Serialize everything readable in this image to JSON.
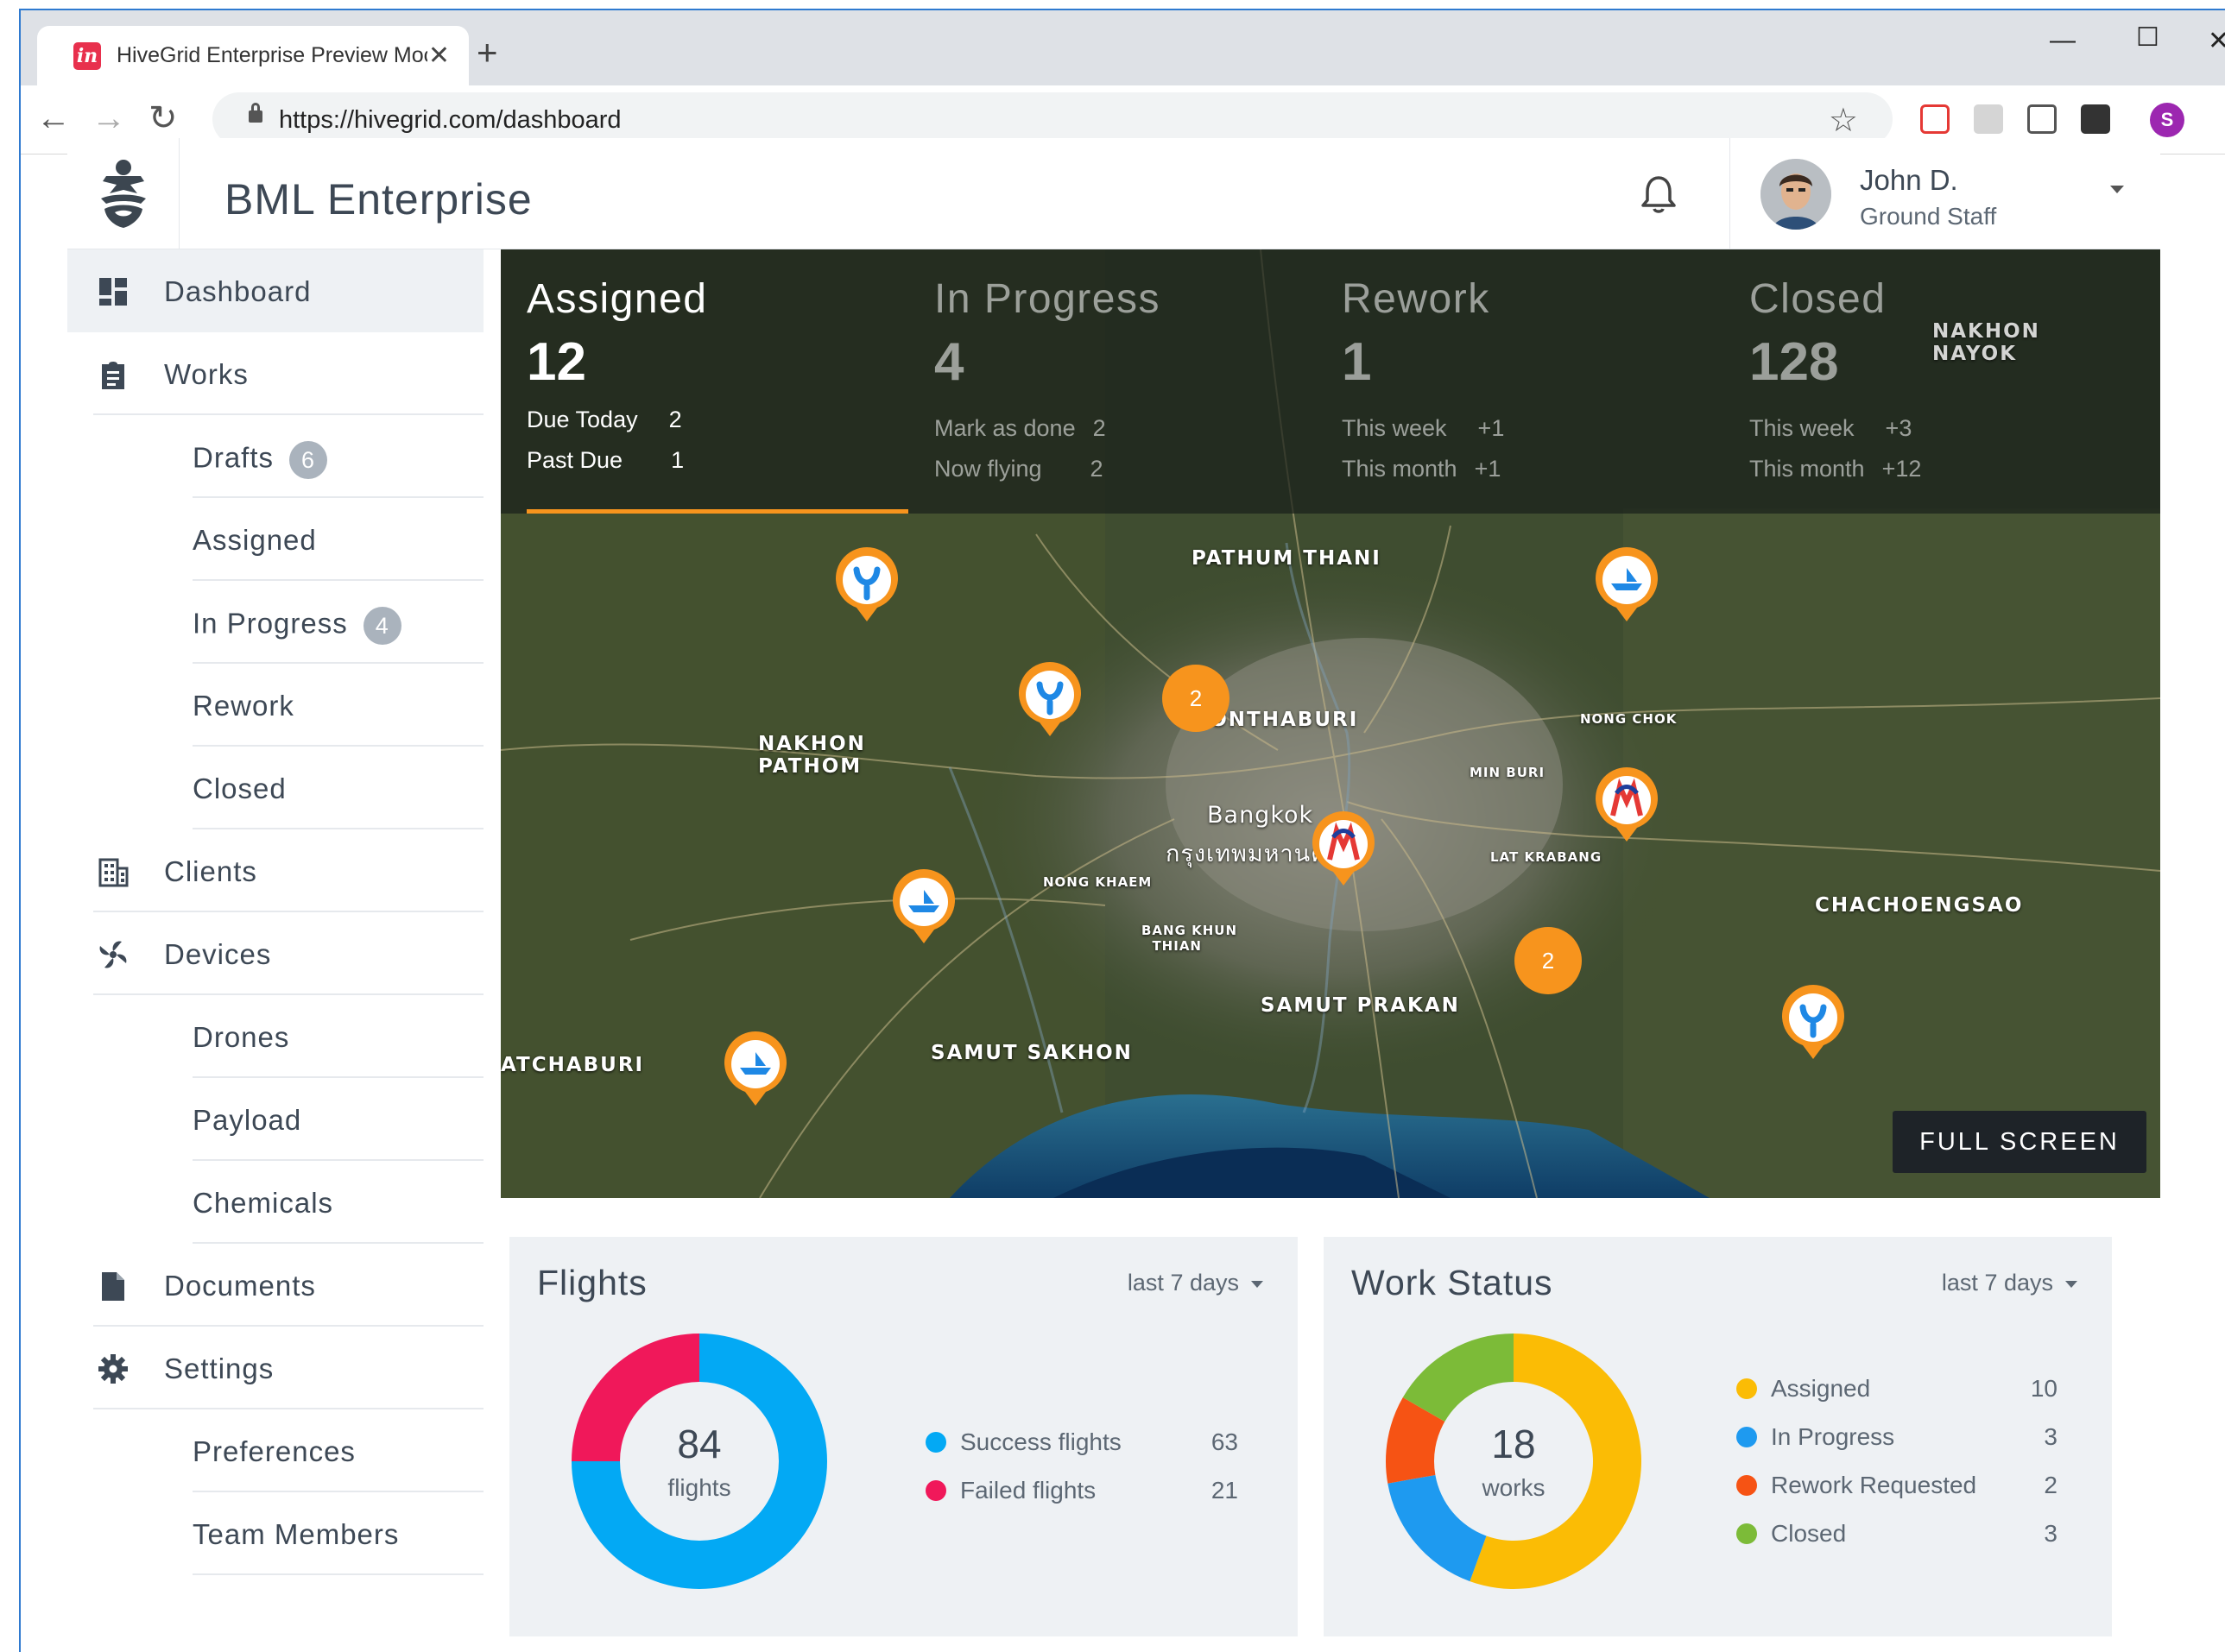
{
  "browser": {
    "tab_title": "HiveGrid Enterprise Preview Moc",
    "url": "https://hivegrid.com/dashboard",
    "profile_initial": "S",
    "new_tab_label": "+",
    "tab_close": "✕"
  },
  "header": {
    "title": "BML Enterprise",
    "user_name": "John D.",
    "user_role": "Ground Staff"
  },
  "sidebar": {
    "items": [
      {
        "label": "Dashboard",
        "icon": "dashboard-icon"
      },
      {
        "label": "Works",
        "icon": "clipboard-icon"
      },
      {
        "label": "Drafts",
        "badge": "6"
      },
      {
        "label": "Assigned"
      },
      {
        "label": "In Progress",
        "badge": "4"
      },
      {
        "label": "Rework"
      },
      {
        "label": "Closed"
      },
      {
        "label": "Clients",
        "icon": "building-icon"
      },
      {
        "label": "Devices",
        "icon": "drone-icon"
      },
      {
        "label": "Drones"
      },
      {
        "label": "Payload"
      },
      {
        "label": "Chemicals"
      },
      {
        "label": "Documents",
        "icon": "document-icon"
      },
      {
        "label": "Settings",
        "icon": "gear-icon"
      },
      {
        "label": "Preferences"
      },
      {
        "label": "Team Members"
      }
    ]
  },
  "stats": [
    {
      "title": "Assigned",
      "value": "12",
      "rows": [
        {
          "label": "Due Today",
          "value": "2"
        },
        {
          "label": "Past Due",
          "value": "1"
        }
      ]
    },
    {
      "title": "In Progress",
      "value": "4",
      "rows": [
        {
          "label": "Mark as done",
          "value": "2"
        },
        {
          "label": "Now flying",
          "value": "2"
        }
      ]
    },
    {
      "title": "Rework",
      "value": "1",
      "rows": [
        {
          "label": "This week",
          "value": "+1"
        },
        {
          "label": "This month",
          "value": "+1"
        }
      ]
    },
    {
      "title": "Closed",
      "value": "128",
      "rows": [
        {
          "label": "This week",
          "value": "+3"
        },
        {
          "label": "This month",
          "value": "+12"
        }
      ]
    }
  ],
  "map": {
    "full_screen_label": "FULL SCREEN",
    "labels": {
      "pathum_thani": "PATHUM THANI",
      "nonthaburi": "NONTHABURI",
      "nakhon_pathom_1": "NAKHON",
      "nakhon_pathom_2": "PATHOM",
      "bangkok": "Bangkok",
      "bangkok_thai": "กรุงเทพมหานคร",
      "samut_prakan": "SAMUT PRAKAN",
      "samut_sakhon": "SAMUT SAKHON",
      "chachoengsao": "CHACHOENGSAO",
      "ratchaburi": "ATCHABURI",
      "nakhon_nayok_1": "NAKHON",
      "nakhon_nayok_2": "NAYOK",
      "nong_chok": "NONG CHOK",
      "min_buri": "MIN BURI",
      "lat_krabang": "LAT KRABANG",
      "nong_khaem": "NONG KHAEM",
      "bang_khun_thian": "BANG KHUN",
      "bang_khun_thian_2": "THIAN"
    },
    "clusters": [
      "2",
      "2"
    ]
  },
  "flights_card": {
    "title": "Flights",
    "filter": "last 7 days",
    "total": "84",
    "unit": "flights",
    "legend": [
      {
        "label": "Success flights",
        "value": "63",
        "color": "#03a9f4"
      },
      {
        "label": "Failed flights",
        "value": "21",
        "color": "#f0185a"
      }
    ]
  },
  "work_card": {
    "title": "Work Status",
    "filter": "last 7 days",
    "total": "18",
    "unit": "works",
    "legend": [
      {
        "label": "Assigned",
        "value": "10",
        "color": "#fbbc05"
      },
      {
        "label": "In Progress",
        "value": "3",
        "color": "#1e9af0"
      },
      {
        "label": "Rework Requested",
        "value": "2",
        "color": "#f65314"
      },
      {
        "label": "Closed",
        "value": "3",
        "color": "#7cbb38"
      }
    ]
  }
}
